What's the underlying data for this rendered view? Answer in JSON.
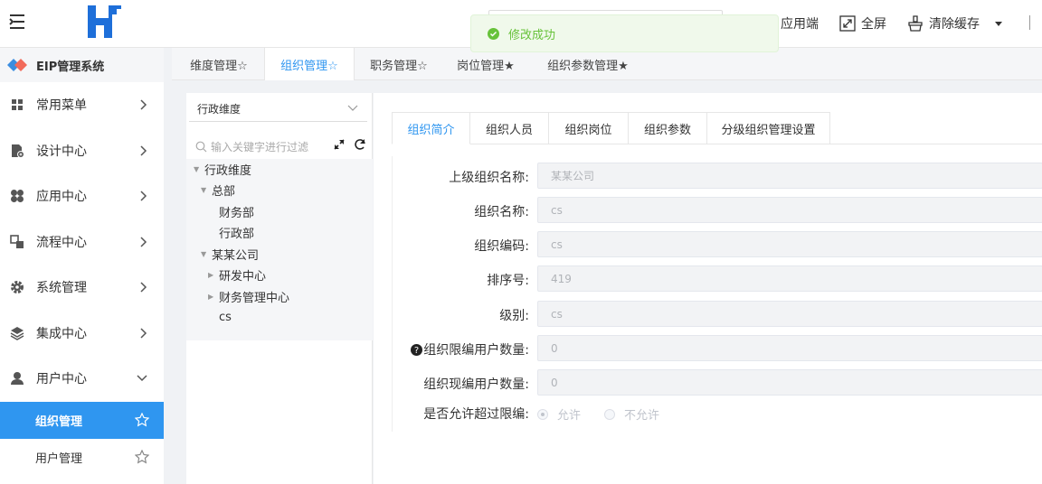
{
  "header": {
    "menu_toggle_icon": "menu-fold-icon",
    "logo_icon": "h-logo-icon",
    "tools": [
      {
        "label": "应用端",
        "icon": ""
      },
      {
        "label": "全屏",
        "icon": "fullscreen-icon"
      },
      {
        "label": "清除缓存",
        "icon": "broom-icon"
      }
    ],
    "dropdown_icon": "caret-down-icon"
  },
  "toast": {
    "message": "修改成功",
    "icon": "check-circle-icon",
    "color": "#67c23a"
  },
  "sidebar": {
    "brand": "EIP管理系统",
    "items": [
      {
        "label": "常用菜单",
        "icon": "grid-icon"
      },
      {
        "label": "设计中心",
        "icon": "design-icon"
      },
      {
        "label": "应用中心",
        "icon": "apps-icon"
      },
      {
        "label": "流程中心",
        "icon": "flow-icon"
      },
      {
        "label": "系统管理",
        "icon": "gear-icon"
      },
      {
        "label": "集成中心",
        "icon": "layers-icon"
      },
      {
        "label": "用户中心",
        "icon": "user-icon"
      }
    ],
    "sub_items": [
      {
        "label": "组织管理",
        "active": true
      },
      {
        "label": "用户管理",
        "active": false
      }
    ],
    "accent": "#2f96f0"
  },
  "page_tabs": [
    {
      "label": "维度管理☆"
    },
    {
      "label": "组织管理☆"
    },
    {
      "label": "职务管理☆"
    },
    {
      "label": "岗位管理★"
    },
    {
      "label": "组织参数管理★"
    }
  ],
  "tree_panel": {
    "dimension_select": "行政维度",
    "search_placeholder": "输入关键字进行过滤",
    "nodes": [
      {
        "label": "行政维度"
      },
      {
        "label": "总部"
      },
      {
        "label": "财务部"
      },
      {
        "label": "行政部"
      },
      {
        "label": "某某公司"
      },
      {
        "label": "研发中心"
      },
      {
        "label": "财务管理中心"
      },
      {
        "label": "cs"
      }
    ]
  },
  "form_tabs": [
    {
      "label": "组织简介"
    },
    {
      "label": "组织人员"
    },
    {
      "label": "组织岗位"
    },
    {
      "label": "组织参数"
    },
    {
      "label": "分级组织管理设置"
    }
  ],
  "form": {
    "parent_org_label": "上级组织名称:",
    "parent_org_value": "某某公司",
    "org_name_label": "组织名称:",
    "org_name_value": "cs",
    "org_code_label": "组织编码:",
    "org_code_value": "cs",
    "sort_label": "排序号:",
    "sort_value": "419",
    "level_label": "级别:",
    "level_value": "cs",
    "limit_label": "组织限编用户数量:",
    "limit_value": "0",
    "current_label": "组织现编用户数量:",
    "current_value": "0",
    "allow_exceed_label": "是否允许超过限编:",
    "allow_option": "允许",
    "deny_option": "不允许"
  }
}
